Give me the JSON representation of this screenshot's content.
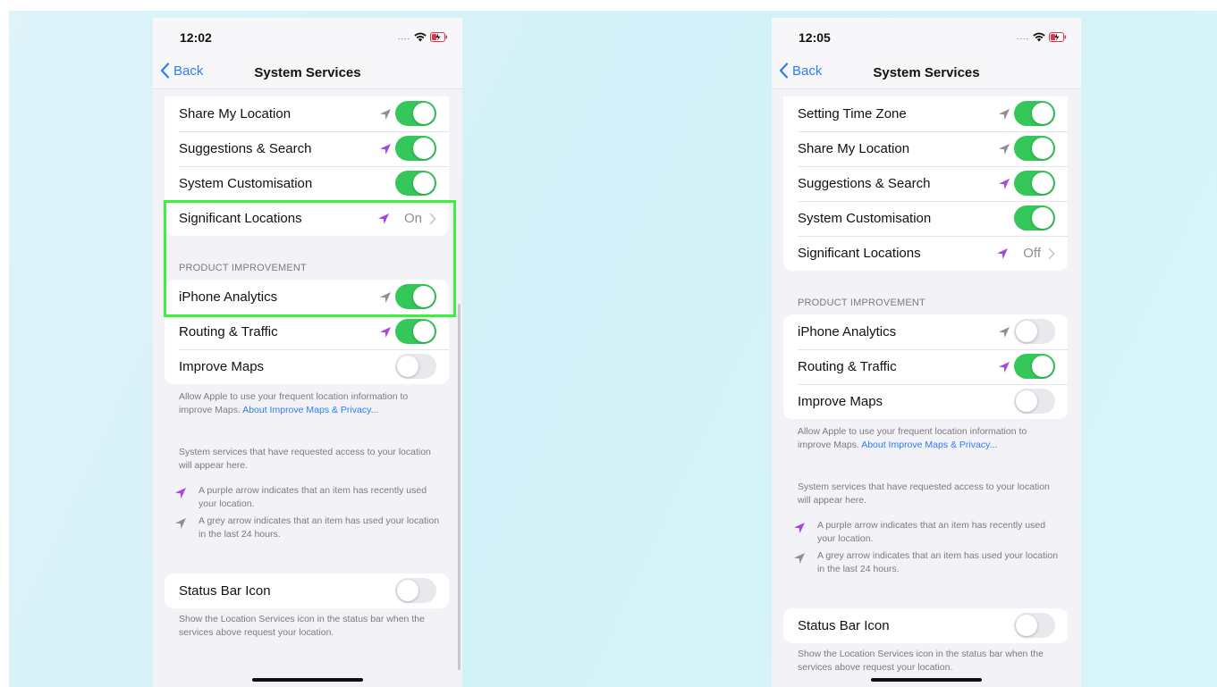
{
  "phones": [
    {
      "time": "12:02",
      "back_label": "Back",
      "title": "System Services",
      "group1_rows": [
        {
          "label": "Share My Location",
          "arrow": "grey-location-arrow-icon",
          "toggle_on": true
        },
        {
          "label": "Suggestions & Search",
          "arrow": "purple-location-arrow-icon",
          "toggle_on": true
        },
        {
          "label": "System Customisation",
          "arrow": null,
          "toggle_on": true
        },
        {
          "label": "Significant Locations",
          "arrow": "purple-location-arrow-icon",
          "value": "On"
        }
      ],
      "section_header": "PRODUCT IMPROVEMENT",
      "group2_rows": [
        {
          "label": "iPhone Analytics",
          "arrow": "grey-location-arrow-icon",
          "toggle_on": true
        },
        {
          "label": "Routing & Traffic",
          "arrow": "purple-location-arrow-icon",
          "toggle_on": true
        },
        {
          "label": "Improve Maps",
          "arrow": null,
          "toggle_on": false
        }
      ],
      "maps_footnote": "Allow Apple to use your frequent location information to improve Maps.",
      "maps_link": "About Improve Maps & Privacy...",
      "services_note": "System services that have requested access to your location will appear here.",
      "purple_legend": "A purple arrow indicates that an item has recently used your location.",
      "grey_legend": "A grey arrow indicates that an item has used your location in the last 24 hours.",
      "status_bar_icon_label": "Status Bar Icon",
      "status_bar_icon_on": false,
      "status_bar_footnote": "Show the Location Services icon in the status bar when the services above request your location."
    },
    {
      "time": "12:05",
      "back_label": "Back",
      "title": "System Services",
      "group1_rows": [
        {
          "label": "Setting Time Zone",
          "arrow": "grey-location-arrow-icon",
          "toggle_on": true
        },
        {
          "label": "Share My Location",
          "arrow": "grey-location-arrow-icon",
          "toggle_on": true
        },
        {
          "label": "Suggestions & Search",
          "arrow": "purple-location-arrow-icon",
          "toggle_on": true
        },
        {
          "label": "System Customisation",
          "arrow": null,
          "toggle_on": true
        },
        {
          "label": "Significant Locations",
          "arrow": "purple-location-arrow-icon",
          "value": "Off"
        }
      ],
      "section_header": "PRODUCT IMPROVEMENT",
      "group2_rows": [
        {
          "label": "iPhone Analytics",
          "arrow": "grey-location-arrow-icon",
          "toggle_on": false
        },
        {
          "label": "Routing & Traffic",
          "arrow": "purple-location-arrow-icon",
          "toggle_on": true
        },
        {
          "label": "Improve Maps",
          "arrow": null,
          "toggle_on": false
        }
      ],
      "maps_footnote": "Allow Apple to use your frequent location information to improve Maps.",
      "maps_link": "About Improve Maps & Privacy...",
      "services_note": "System services that have requested access to your location will appear here.",
      "purple_legend": "A purple arrow indicates that an item has recently used your location.",
      "grey_legend": "A grey arrow indicates that an item has used your location in the last 24 hours.",
      "status_bar_icon_label": "Status Bar Icon",
      "status_bar_icon_on": false,
      "status_bar_footnote": "Show the Location Services icon in the status bar when the services above request your location."
    }
  ],
  "colors": {
    "toggle_on": "#34c759",
    "purple_arrow": "#a448e0",
    "grey_arrow": "#8e8e93",
    "link": "#2f7cf6",
    "highlight": "#3af23a"
  }
}
